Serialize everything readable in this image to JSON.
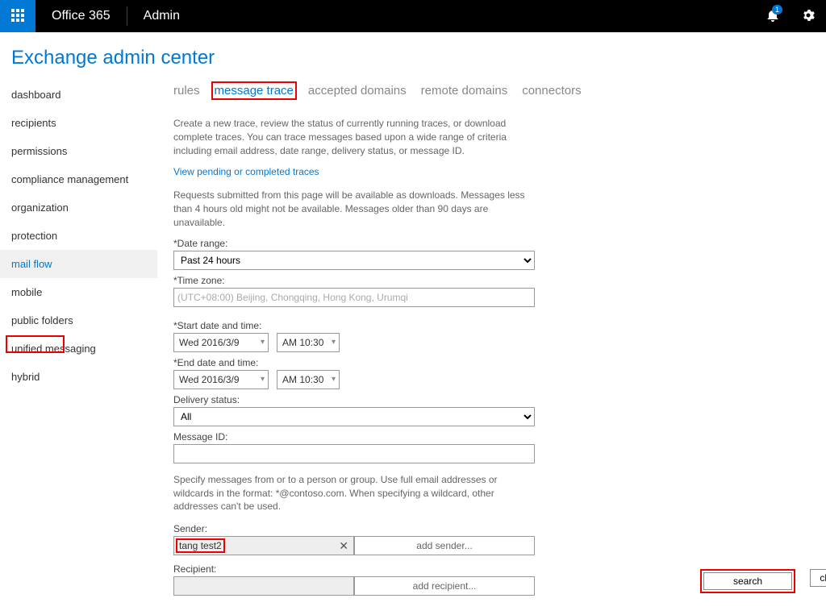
{
  "topbar": {
    "brand": "Office 365",
    "appname": "Admin",
    "notification_count": "1"
  },
  "eac_title": "Exchange admin center",
  "sidebar": {
    "items": [
      {
        "label": "dashboard"
      },
      {
        "label": "recipients"
      },
      {
        "label": "permissions"
      },
      {
        "label": "compliance management"
      },
      {
        "label": "organization"
      },
      {
        "label": "protection"
      },
      {
        "label": "mail flow",
        "active": true
      },
      {
        "label": "mobile"
      },
      {
        "label": "public folders"
      },
      {
        "label": "unified messaging"
      },
      {
        "label": "hybrid"
      }
    ]
  },
  "tabs": [
    {
      "label": "rules"
    },
    {
      "label": "message trace",
      "active": true
    },
    {
      "label": "accepted domains"
    },
    {
      "label": "remote domains"
    },
    {
      "label": "connectors"
    }
  ],
  "intro": "Create a new trace, review the status of currently running traces, or download complete traces. You can trace messages based upon a wide range of criteria including email address, date range, delivery status, or message ID.",
  "pending_link": "View pending or completed traces",
  "availability_note": "Requests submitted from this page will be available as downloads. Messages less than 4 hours old might not be available. Messages older than 90 days are unavailable.",
  "form": {
    "date_range_label": "*Date range:",
    "date_range_value": "Past 24 hours",
    "timezone_label": "*Time zone:",
    "timezone_value": "(UTC+08:00) Beijing, Chongqing, Hong Kong, Urumqi",
    "start_label": "*Start date and time:",
    "start_date": "Wed 2016/3/9",
    "start_time": "AM 10:30",
    "end_label": "*End date and time:",
    "end_date": "Wed 2016/3/9",
    "end_time": "AM 10:30",
    "delivery_status_label": "Delivery status:",
    "delivery_status_value": "All",
    "message_id_label": "Message ID:",
    "message_id_value": "",
    "specify_note": "Specify messages from or to a person or group. Use full email addresses or wildcards in the format: *@contoso.com. When specifying a wildcard, other addresses can't be used.",
    "sender_label": "Sender:",
    "sender_value": "tang test2",
    "add_sender_label": "add sender...",
    "recipient_label": "Recipient:",
    "recipient_value": "",
    "add_recipient_label": "add recipient..."
  },
  "buttons": {
    "search": "search",
    "clear": "cle"
  }
}
